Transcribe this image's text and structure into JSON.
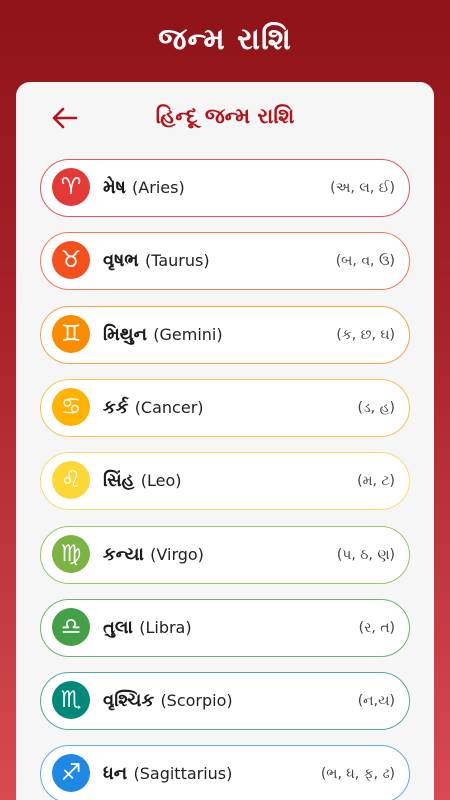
{
  "header": {
    "title": "જન્મ રાશિ"
  },
  "card": {
    "title": "હિન્દૂ જન્મ રાશિ"
  },
  "rashis": [
    {
      "name": "મેષ",
      "english": "(Aries)",
      "letters": "(અ, લ, ઈ)",
      "symbol": "♈",
      "color": "#e53935",
      "border": "#e0595c"
    },
    {
      "name": "વૃષભ",
      "english": "(Taurus)",
      "letters": "(બ, વ, ઉ)",
      "symbol": "♉",
      "color": "#f4511e",
      "border": "#ef7b57"
    },
    {
      "name": "મિથુન",
      "english": "(Gemini)",
      "letters": "(ક, છ, ઘ)",
      "symbol": "♊",
      "color": "#fb8c00",
      "border": "#f5a544"
    },
    {
      "name": "કર્ક",
      "english": "(Cancer)",
      "letters": "(ડ, હ)",
      "symbol": "♋",
      "color": "#ffb300",
      "border": "#f6c453"
    },
    {
      "name": "સિંહ",
      "english": "(Leo)",
      "letters": "(મ, ટ)",
      "symbol": "♌",
      "color": "#fdd835",
      "border": "#f2df6b"
    },
    {
      "name": "કન્યા",
      "english": "(Virgo)",
      "letters": "(પ, ઠ, ણ)",
      "symbol": "♍",
      "color": "#7cb342",
      "border": "#9cc46b"
    },
    {
      "name": "તુલા",
      "english": "(Libra)",
      "letters": "(ર, ત)",
      "symbol": "♎",
      "color": "#43a047",
      "border": "#6cb56f"
    },
    {
      "name": "વૃશ્ચિક",
      "english": "(Scorpio)",
      "letters": "(ન,ય)",
      "symbol": "♏",
      "color": "#00897b",
      "border": "#4eab9f"
    },
    {
      "name": "ધન",
      "english": "(Sagittarius)",
      "letters": "(ભ, ધ, ફ, ઢ)",
      "symbol": "♐",
      "color": "#1e88e5",
      "border": "#64a8e8"
    }
  ]
}
